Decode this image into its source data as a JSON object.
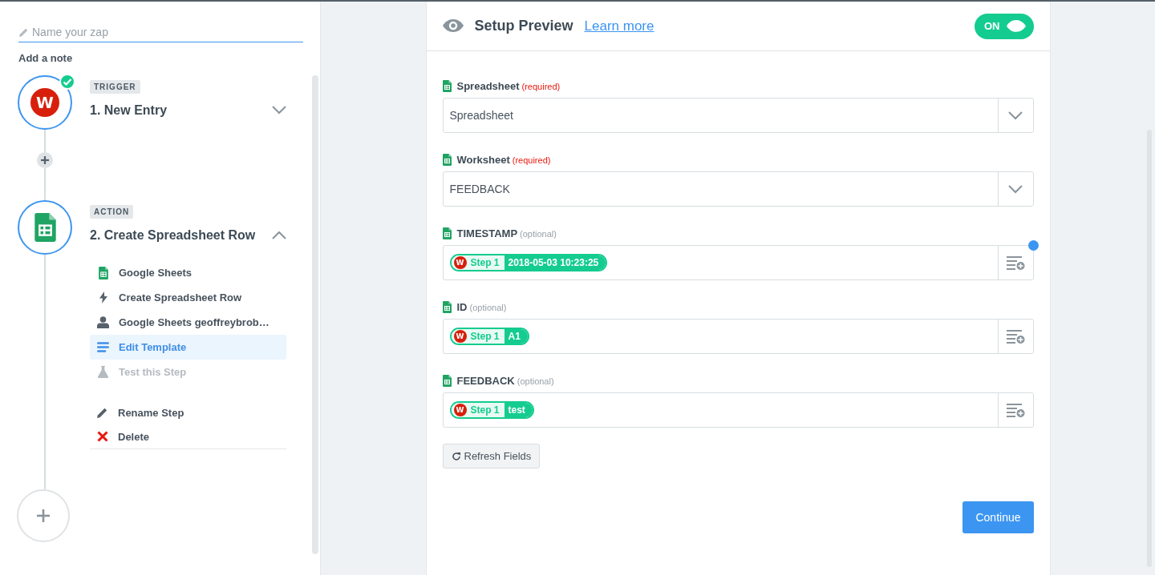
{
  "zap_name": {
    "placeholder": "Name your zap"
  },
  "add_note": "Add a note",
  "steps": [
    {
      "badge": "TRIGGER",
      "title": "1. New Entry",
      "kind": "wufoo",
      "logo_letter": "W",
      "complete": true,
      "expanded": false
    },
    {
      "badge": "ACTION",
      "title": "2. Create Spreadsheet Row",
      "kind": "sheets",
      "complete": false,
      "expanded": true,
      "items": [
        {
          "kind": "app",
          "label": "Google Sheets",
          "selected": false,
          "disabled": false
        },
        {
          "kind": "event",
          "label": "Create Spreadsheet Row",
          "selected": false,
          "disabled": false
        },
        {
          "kind": "account",
          "label": "Google Sheets geoffreybrob…",
          "selected": false,
          "disabled": false
        },
        {
          "kind": "template",
          "label": "Edit Template",
          "selected": true,
          "disabled": false
        },
        {
          "kind": "test",
          "label": "Test this Step",
          "selected": false,
          "disabled": true
        }
      ],
      "actions": [
        {
          "kind": "rename",
          "label": "Rename Step"
        },
        {
          "kind": "delete",
          "label": "Delete"
        }
      ]
    }
  ],
  "header": {
    "title": "Setup Preview",
    "link": "Learn more",
    "toggle": {
      "label": "ON",
      "on": true
    }
  },
  "fields": [
    {
      "kind": "dropdown",
      "label": "Spreadsheet",
      "qualifier": "(required)",
      "required": true,
      "value": "Spreadsheet",
      "dot": false
    },
    {
      "kind": "dropdown",
      "label": "Worksheet",
      "qualifier": "(required)",
      "required": true,
      "value": "FEEDBACK",
      "dot": false
    },
    {
      "kind": "tokens",
      "label": "TIMESTAMP",
      "qualifier": "(optional)",
      "required": false,
      "dot": true,
      "tokens": [
        {
          "logo_letter": "W",
          "step": "Step 1",
          "value": "2018-05-03 10:23:25"
        }
      ]
    },
    {
      "kind": "tokens",
      "label": "ID",
      "qualifier": "(optional)",
      "required": false,
      "dot": false,
      "tokens": [
        {
          "logo_letter": "W",
          "step": "Step 1",
          "value": "A1"
        }
      ]
    },
    {
      "kind": "tokens",
      "label": "FEEDBACK",
      "qualifier": "(optional)",
      "required": false,
      "dot": false,
      "tokens": [
        {
          "logo_letter": "W",
          "step": "Step 1",
          "value": "test"
        }
      ]
    }
  ],
  "refresh_button": "Refresh Fields",
  "continue_button": "Continue"
}
